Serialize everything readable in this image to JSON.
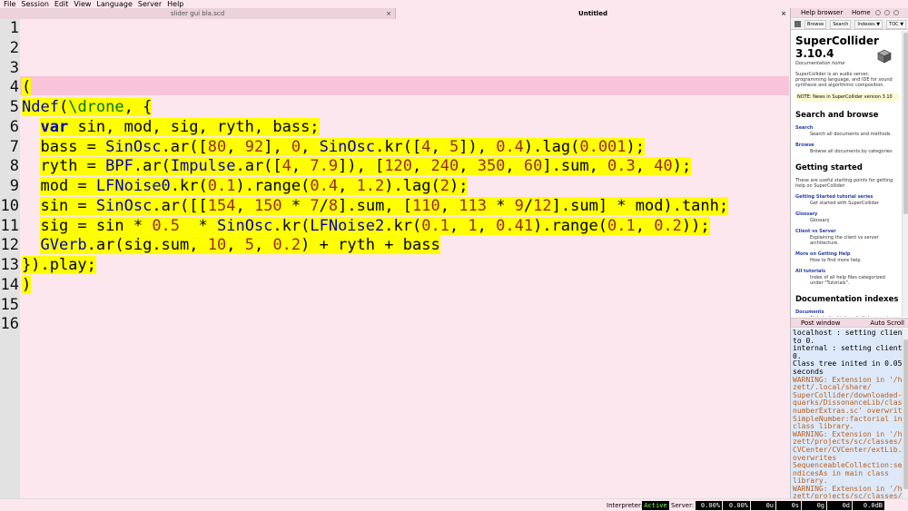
{
  "menu": [
    "File",
    "Session",
    "Edit",
    "View",
    "Language",
    "Server",
    "Help"
  ],
  "tabs": [
    {
      "label": "slider gui bla.scd",
      "close": "×"
    },
    {
      "label": "Untitled",
      "close": "×"
    }
  ],
  "editor": {
    "line_numbers": [
      "1",
      "2",
      "3",
      "4",
      "5",
      "6",
      "7",
      "8",
      "9",
      "10",
      "11",
      "12",
      "13",
      "14",
      "15",
      "16"
    ],
    "current_line": 4,
    "code_lines": [
      "(",
      "Ndef(\\drone, {",
      "  var sin, mod, sig, ryth, bass;",
      "  bass = SinOsc.ar([80, 92], 0, SinOsc.kr([4, 5]), 0.4).lag(0.001);",
      "  ryth = BPF.ar(Impulse.ar([4, 7.9]), [120, 240, 350, 60].sum, 0.3, 40);",
      "  mod = LFNoise0.kr(0.1).range(0.4, 1.2).lag(2);",
      "  sin = SinOsc.ar([[154, 150 * 7/8].sum, [110, 113 * 9/12].sum] * mod).tanh;",
      "  sig = sin * 0.5  * SinOsc.kr(LFNoise2.kr(0.1, 1, 0.41).range(0.1, 0.2));",
      "  GVerb.ar(sig.sum, 10, 5, 0.2) + ryth + bass",
      "}).play;",
      ")"
    ],
    "selection_color": "#ffff00"
  },
  "help": {
    "title": "Help browser",
    "home": "Home",
    "toolbar": [
      "Browse",
      "Search",
      "Indexes ▼",
      "TOC ▼"
    ],
    "doc_title_1": "SuperCollider",
    "doc_title_2": "3.10.4",
    "doc_subtitle": "Documentation home",
    "intro": "SuperCollider is an audio server, programming language, and IDE for sound synthesis and algorithmic composition.",
    "note": "NOTE: News in SuperCollider version 3.10",
    "sections": [
      {
        "heading": "Search and browse",
        "links": [
          {
            "name": "Search",
            "desc": "Search all documents and methods"
          },
          {
            "name": "Browse",
            "desc": "Browse all documents by categories"
          }
        ]
      },
      {
        "heading": "Getting started",
        "intro": "These are useful starting points for getting help on SuperCollider:",
        "links": [
          {
            "name": "Getting Started tutorial series",
            "desc": "Get started with SuperCollider"
          },
          {
            "name": "Glossary",
            "desc": "Glossary"
          },
          {
            "name": "Client vs Server",
            "desc": "Explaining the client vs server architecture."
          },
          {
            "name": "More on Getting Help",
            "desc": "How to find more help"
          },
          {
            "name": "All tutorials",
            "desc": "Index of all help files categorized under \"Tutorials\"."
          }
        ]
      },
      {
        "heading": "Documentation indexes",
        "links": [
          {
            "name": "Documents",
            "desc": "Alphabetical index of all documents"
          }
        ]
      }
    ]
  },
  "post": {
    "title": "Post window",
    "auto_scroll": "Auto Scroll",
    "lines": [
      {
        "t": "n",
        "text": "localhost : setting clientID"
      },
      {
        "t": "n",
        "text": "to 0."
      },
      {
        "t": "n",
        "text": "internal : setting clientID to"
      },
      {
        "t": "n",
        "text": "0."
      },
      {
        "t": "n",
        "text": "Class tree inited in 0.05"
      },
      {
        "t": "n",
        "text": "seconds"
      },
      {
        "t": "w",
        "text": "WARNING: Extension in '/home/"
      },
      {
        "t": "w",
        "text": "zett/.local/share/"
      },
      {
        "t": "w",
        "text": "SuperCollider/downloaded-"
      },
      {
        "t": "w",
        "text": "quarks/DissonanceLib/classes/"
      },
      {
        "t": "w",
        "text": "numberExtras.sc' overwrites"
      },
      {
        "t": "w",
        "text": "SimpleNumber:factorial in main"
      },
      {
        "t": "w",
        "text": "class library."
      },
      {
        "t": "w",
        "text": "WARNING: Extension in '/home/"
      },
      {
        "t": "w",
        "text": "zett/projects/sc/classes/"
      },
      {
        "t": "w",
        "text": "CVCenter/CVCenter/extLib.sc'"
      },
      {
        "t": "w",
        "text": "overwrites"
      },
      {
        "t": "w",
        "text": "SequenceableCollection:selectI"
      },
      {
        "t": "w",
        "text": "ndicesAs in main class"
      },
      {
        "t": "w",
        "text": "library."
      },
      {
        "t": "w",
        "text": "WARNING: Extension in '/home/"
      },
      {
        "t": "w",
        "text": "zett/projects/sc/classes/"
      }
    ]
  },
  "status": {
    "interpreter_label": "Interpreter:",
    "interpreter_state": "Active",
    "server_label": "Server:",
    "values": [
      "0.00%",
      "0.00%",
      "0u",
      "0s",
      "0g",
      "0d",
      "0.0dB"
    ]
  }
}
